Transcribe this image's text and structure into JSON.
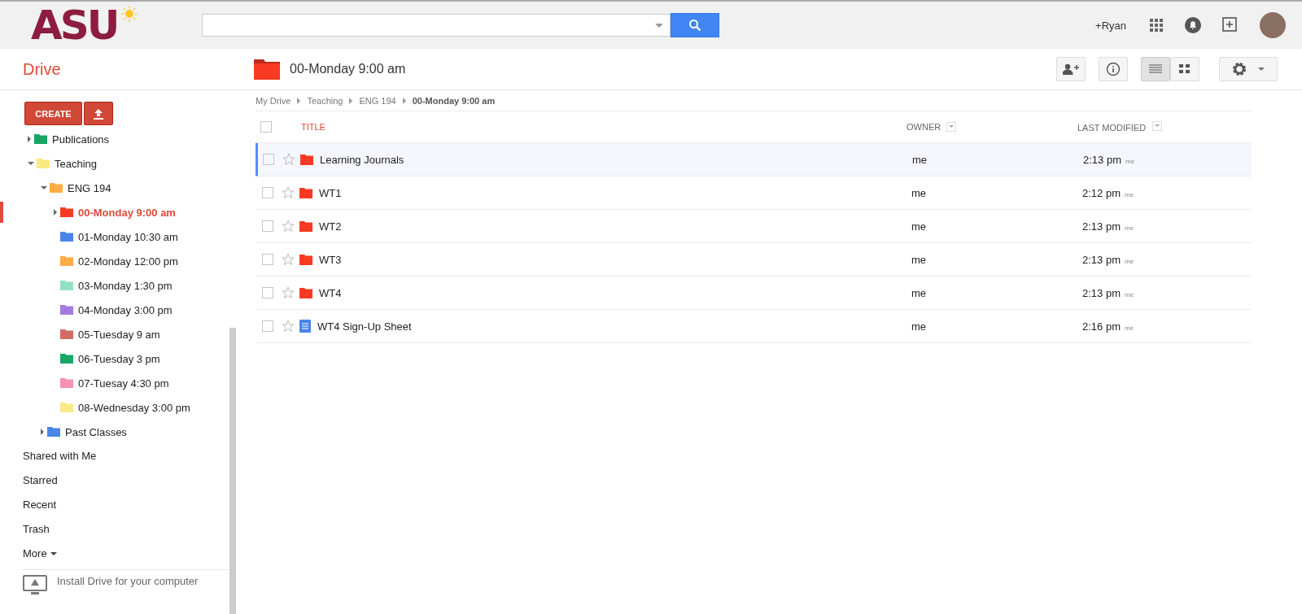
{
  "header": {
    "logo": "ASU",
    "user": "+Ryan"
  },
  "app_title": "Drive",
  "sidebar": {
    "create": "CREATE",
    "tree": [
      {
        "label": "Publications",
        "color": "#16a765",
        "expanded": false,
        "selected": false
      },
      {
        "label": "Teaching",
        "color": "#fbe983",
        "expanded": true,
        "selected": false,
        "children": [
          {
            "label": "ENG 194",
            "color": "#ffad46",
            "expanded": true,
            "selected": false,
            "children": [
              {
                "label": "00-Monday 9:00 am",
                "color": "#f83a22",
                "expanded": false,
                "selected": true
              },
              {
                "label": "01-Monday 10:30 am",
                "color": "#4986e7",
                "selected": false
              },
              {
                "label": "02-Monday 12:00 pm",
                "color": "#ffad46",
                "selected": false
              },
              {
                "label": "03-Monday 1:30 pm",
                "color": "#92e1c0",
                "selected": false
              },
              {
                "label": "04-Monday 3:00 pm",
                "color": "#a47ae2",
                "selected": false
              },
              {
                "label": "05-Tuesday 9 am",
                "color": "#d06b64",
                "selected": false
              },
              {
                "label": "06-Tuesday 3 pm",
                "color": "#16a765",
                "selected": false
              },
              {
                "label": "07-Tuesay 4:30 pm",
                "color": "#f691b2",
                "selected": false
              },
              {
                "label": "08-Wednesday 3:00 pm",
                "color": "#fbe983",
                "selected": false
              }
            ]
          },
          {
            "label": "Past Classes",
            "color": "#4986e7",
            "expanded": false,
            "selected": false
          }
        ]
      }
    ],
    "links": [
      "Shared with Me",
      "Starred",
      "Recent",
      "Trash"
    ],
    "more": "More",
    "install": "Install Drive for your computer"
  },
  "folder": {
    "title": "00-Monday 9:00 am",
    "color": "#f83a22"
  },
  "breadcrumb": [
    "My Drive",
    "Teaching",
    "ENG 194",
    "00-Monday 9:00 am"
  ],
  "table": {
    "select_all": {
      "checked": false
    },
    "columns": [
      "TITLE",
      "OWNER",
      "LAST MODIFIED"
    ],
    "rows": [
      {
        "kind": "folder",
        "title": "Learning Journals",
        "owner": "me",
        "modified": "2:13 pm",
        "by": "me",
        "focused": true,
        "checked": false,
        "starred": false
      },
      {
        "kind": "folder",
        "title": "WT1",
        "owner": "me",
        "modified": "2:12 pm",
        "by": "me",
        "focused": false,
        "checked": false,
        "starred": false
      },
      {
        "kind": "folder",
        "title": "WT2",
        "owner": "me",
        "modified": "2:13 pm",
        "by": "me",
        "focused": false,
        "checked": false,
        "starred": false
      },
      {
        "kind": "folder",
        "title": "WT3",
        "owner": "me",
        "modified": "2:13 pm",
        "by": "me",
        "focused": false,
        "checked": false,
        "starred": false
      },
      {
        "kind": "folder",
        "title": "WT4",
        "owner": "me",
        "modified": "2:13 pm",
        "by": "me",
        "focused": false,
        "checked": false,
        "starred": false
      },
      {
        "kind": "doc",
        "title": "WT4 Sign-Up Sheet",
        "owner": "me",
        "modified": "2:16 pm",
        "by": "me",
        "focused": false,
        "checked": false,
        "starred": false
      }
    ]
  }
}
